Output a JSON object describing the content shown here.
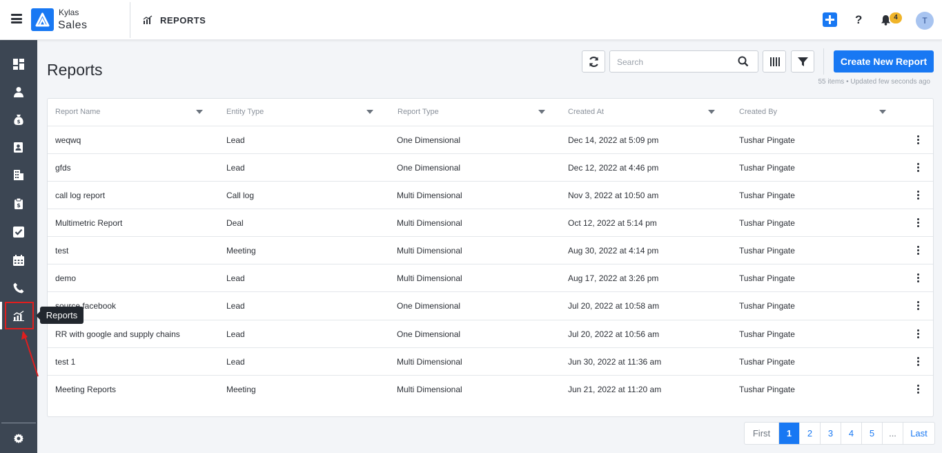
{
  "header": {
    "brand_top": "Kylas",
    "brand_bottom": "Sales",
    "page_crumb": "REPORTS",
    "notification_count": "4",
    "avatar_initial": "T"
  },
  "sidebar": {
    "items": [
      {
        "name": "dashboard-icon"
      },
      {
        "name": "contacts-icon"
      },
      {
        "name": "deals-icon"
      },
      {
        "name": "address-book-icon"
      },
      {
        "name": "companies-icon"
      },
      {
        "name": "tasks-clipboard-icon"
      },
      {
        "name": "checkbox-icon"
      },
      {
        "name": "calendar-icon"
      },
      {
        "name": "phone-icon"
      },
      {
        "name": "reports-icon"
      },
      {
        "name": "settings-icon"
      }
    ],
    "active": "reports",
    "tooltip": "Reports",
    "highlight_color": "#e01e1e"
  },
  "main": {
    "title": "Reports",
    "search_placeholder": "Search",
    "create_button": "Create New Report",
    "meta": "55 items • Updated few seconds ago",
    "columns": [
      "Report Name",
      "Entity Type",
      "Report Type",
      "Created At",
      "Created By"
    ],
    "rows": [
      {
        "name": "weqwq",
        "entity": "Lead",
        "type": "One Dimensional",
        "created_at": "Dec 14, 2022 at 5:09 pm",
        "created_by": "Tushar Pingate"
      },
      {
        "name": "gfds",
        "entity": "Lead",
        "type": "One Dimensional",
        "created_at": "Dec 12, 2022 at 4:46 pm",
        "created_by": "Tushar Pingate"
      },
      {
        "name": "call log report",
        "entity": "Call log",
        "type": "Multi Dimensional",
        "created_at": "Nov 3, 2022 at 10:50 am",
        "created_by": "Tushar Pingate"
      },
      {
        "name": "Multimetric Report",
        "entity": "Deal",
        "type": "Multi Dimensional",
        "created_at": "Oct 12, 2022 at 5:14 pm",
        "created_by": "Tushar Pingate"
      },
      {
        "name": "test",
        "entity": "Meeting",
        "type": "Multi Dimensional",
        "created_at": "Aug 30, 2022 at 4:14 pm",
        "created_by": "Tushar Pingate"
      },
      {
        "name": "demo",
        "entity": "Lead",
        "type": "Multi Dimensional",
        "created_at": "Aug 17, 2022 at 3:26 pm",
        "created_by": "Tushar Pingate"
      },
      {
        "name": "source facebook",
        "entity": "Lead",
        "type": "One Dimensional",
        "created_at": "Jul 20, 2022 at 10:58 am",
        "created_by": "Tushar Pingate"
      },
      {
        "name": "RR with google and supply chains",
        "entity": "Lead",
        "type": "One Dimensional",
        "created_at": "Jul 20, 2022 at 10:56 am",
        "created_by": "Tushar Pingate"
      },
      {
        "name": "test 1",
        "entity": "Lead",
        "type": "Multi Dimensional",
        "created_at": "Jun 30, 2022 at 11:36 am",
        "created_by": "Tushar Pingate"
      },
      {
        "name": "Meeting Reports",
        "entity": "Meeting",
        "type": "Multi Dimensional",
        "created_at": "Jun 21, 2022 at 11:20 am",
        "created_by": "Tushar Pingate"
      }
    ]
  },
  "pagination": {
    "first": "First",
    "pages": [
      "1",
      "2",
      "3",
      "4",
      "5"
    ],
    "active_page": "1",
    "ellipsis": "...",
    "last": "Last"
  },
  "colors": {
    "accent": "#1878f3",
    "sidebar": "#3c4653",
    "badge": "#f0b429"
  }
}
